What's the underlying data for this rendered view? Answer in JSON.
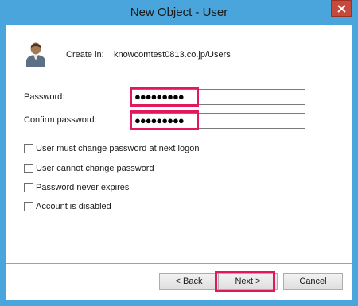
{
  "window": {
    "title": "New Object - User"
  },
  "header": {
    "create_in_label": "Create in:",
    "create_in_value": "knowcomtest0813.co.jp/Users"
  },
  "fields": {
    "password_label": "Password:",
    "password_value": "●●●●●●●●●",
    "confirm_label": "Confirm password:",
    "confirm_value": "●●●●●●●●●"
  },
  "options": [
    {
      "label": "User must change password at next logon",
      "checked": false
    },
    {
      "label": "User cannot change password",
      "checked": false
    },
    {
      "label": "Password never expires",
      "checked": false
    },
    {
      "label": "Account is disabled",
      "checked": false
    }
  ],
  "buttons": {
    "back": "< Back",
    "next": "Next >",
    "cancel": "Cancel"
  },
  "icons": {
    "user": "user-icon",
    "close": "close-icon"
  },
  "colors": {
    "highlight": "#e3175c",
    "titlebar": "#49a5db",
    "close": "#c7493b"
  }
}
